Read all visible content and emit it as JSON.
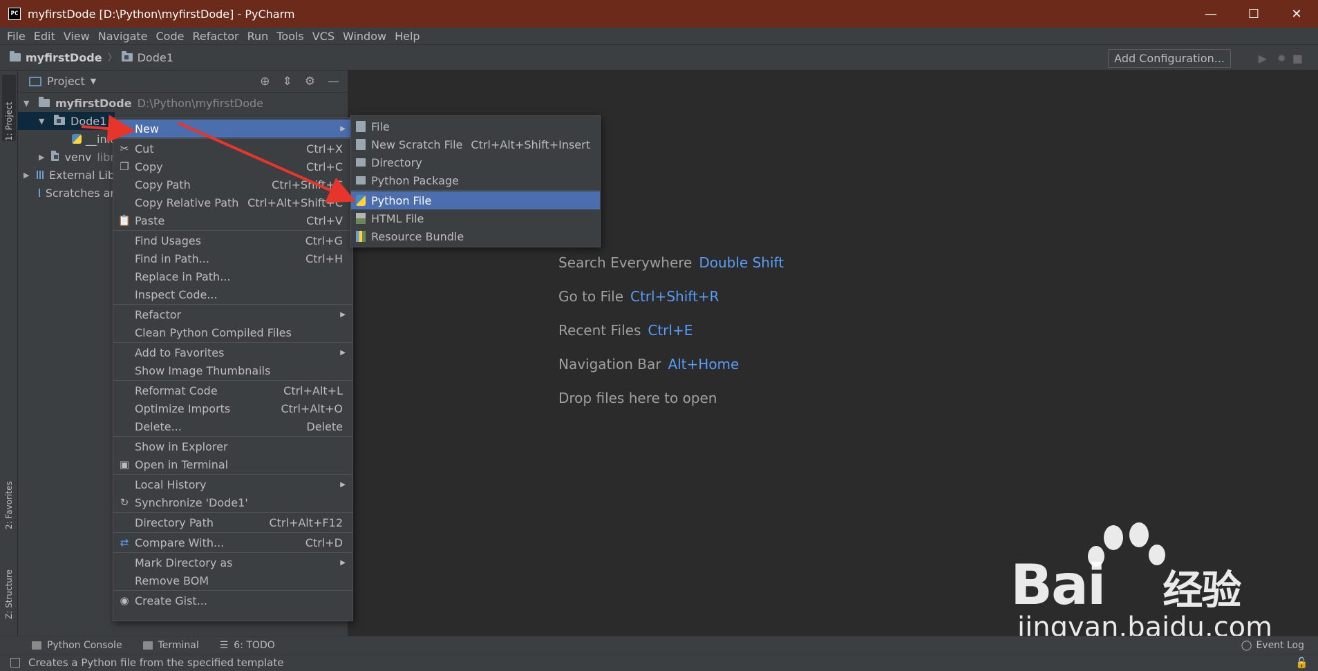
{
  "window": {
    "title": "myfirstDode [D:\\Python\\myfirstDode] - PyCharm",
    "app_icon_text": "PC",
    "minimize": "—",
    "maximize": "☐",
    "close": "✕"
  },
  "menubar": [
    "File",
    "Edit",
    "View",
    "Navigate",
    "Code",
    "Refactor",
    "Run",
    "Tools",
    "VCS",
    "Window",
    "Help"
  ],
  "navbar": {
    "project": "myfirstDode",
    "folder": "Dode1",
    "add_configuration": "Add Configuration..."
  },
  "left_strip": {
    "project_tab": "1: Project",
    "favorites_tab": "2: Favorites",
    "structure_tab": "Z: Structure"
  },
  "project_panel": {
    "header": "Project",
    "tree": [
      {
        "label": "myfirstDode",
        "path": "D:\\Python\\myfirstDode"
      },
      {
        "label": "Dode1"
      },
      {
        "label": "__init"
      },
      {
        "label": "venv",
        "path": "libr"
      },
      {
        "label": "External Lib"
      },
      {
        "label": "Scratches ar"
      }
    ]
  },
  "context_menu": {
    "new": "New",
    "cut": {
      "label": "Cut",
      "shortcut": "Ctrl+X"
    },
    "copy": {
      "label": "Copy",
      "shortcut": "Ctrl+C"
    },
    "copy_path": {
      "label": "Copy Path",
      "shortcut": "Ctrl+Shift+C"
    },
    "copy_relative_path": {
      "label": "Copy Relative Path",
      "shortcut": "Ctrl+Alt+Shift+C"
    },
    "paste": {
      "label": "Paste",
      "shortcut": "Ctrl+V"
    },
    "find_usages": {
      "label": "Find Usages",
      "shortcut": "Ctrl+G"
    },
    "find_in_path": {
      "label": "Find in Path...",
      "shortcut": "Ctrl+H"
    },
    "replace_in_path": "Replace in Path...",
    "inspect_code": "Inspect Code...",
    "refactor": "Refactor",
    "clean_python": "Clean Python Compiled Files",
    "add_to_favorites": "Add to Favorites",
    "show_image_thumbnails": "Show Image Thumbnails",
    "reformat_code": {
      "label": "Reformat Code",
      "shortcut": "Ctrl+Alt+L"
    },
    "optimize_imports": {
      "label": "Optimize Imports",
      "shortcut": "Ctrl+Alt+O"
    },
    "delete": {
      "label": "Delete...",
      "shortcut": "Delete"
    },
    "show_in_explorer": "Show in Explorer",
    "open_in_terminal": "Open in Terminal",
    "local_history": "Local History",
    "synchronize": "Synchronize 'Dode1'",
    "directory_path": {
      "label": "Directory Path",
      "shortcut": "Ctrl+Alt+F12"
    },
    "compare_with": {
      "label": "Compare With...",
      "shortcut": "Ctrl+D"
    },
    "mark_directory_as": "Mark Directory as",
    "remove_bom": "Remove BOM",
    "create_gist": "Create Gist..."
  },
  "submenu": {
    "file": "File",
    "new_scratch": {
      "label": "New Scratch File",
      "shortcut": "Ctrl+Alt+Shift+Insert"
    },
    "directory": "Directory",
    "python_package": "Python Package",
    "python_file": "Python File",
    "html_file": "HTML File",
    "resource_bundle": "Resource Bundle"
  },
  "editor_hints": [
    {
      "label": "Search Everywhere",
      "key": "Double Shift"
    },
    {
      "label": "Go to File",
      "key": "Ctrl+Shift+R"
    },
    {
      "label": "Recent Files",
      "key": "Ctrl+E"
    },
    {
      "label": "Navigation Bar",
      "key": "Alt+Home"
    },
    {
      "label": "Drop files here to open",
      "key": ""
    }
  ],
  "bottombar": {
    "python_console": "Python Console",
    "terminal": "Terminal",
    "todo": "6: TODO",
    "event_log": "Event Log"
  },
  "statusbar": {
    "message": "Creates a Python file from the specified template"
  },
  "watermark": {
    "logo": "Bai",
    "logo_suffix": "经验",
    "site": "jingyan.baidu.com"
  },
  "colors": {
    "accent": "#4b6eaf",
    "shortcut_blue": "#589df6",
    "arrow_red": "#e8352c",
    "titlebar": "#6b2a1a"
  }
}
